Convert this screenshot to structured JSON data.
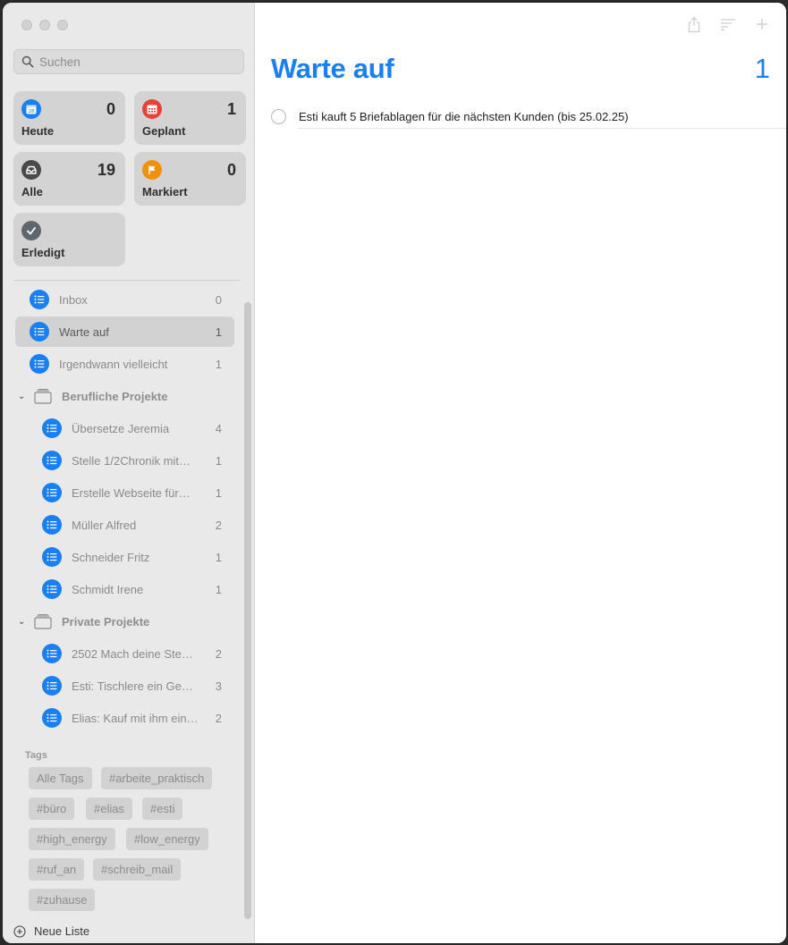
{
  "search": {
    "placeholder": "Suchen"
  },
  "smart_lists": [
    {
      "label": "Heute",
      "count": "0",
      "color": "#1a7ff0",
      "icon": "calendar-icon"
    },
    {
      "label": "Geplant",
      "count": "1",
      "color": "#e8413a",
      "icon": "calendar-grid-icon"
    },
    {
      "label": "Alle",
      "count": "19",
      "color": "#4a4a4a",
      "icon": "inbox-tray-icon"
    },
    {
      "label": "Markiert",
      "count": "0",
      "color": "#f0900c",
      "icon": "flag-icon"
    },
    {
      "label": "Erledigt",
      "count": "",
      "color": "#5e6670",
      "icon": "checkmark-icon"
    }
  ],
  "lists": [
    {
      "name": "Inbox",
      "count": "0"
    },
    {
      "name": "Warte auf",
      "count": "1",
      "selected": true
    },
    {
      "name": "Irgendwann vielleicht",
      "count": "1"
    }
  ],
  "groups": [
    {
      "name": "Berufliche Projekte",
      "items": [
        {
          "name": "Übersetze Jeremia",
          "count": "4"
        },
        {
          "name": "Stelle 1/2Chronik mit…",
          "count": "1"
        },
        {
          "name": "Erstelle Webseite für…",
          "count": "1"
        },
        {
          "name": "Müller Alfred",
          "count": "2"
        },
        {
          "name": "Schneider Fritz",
          "count": "1"
        },
        {
          "name": "Schmidt Irene",
          "count": "1"
        }
      ]
    },
    {
      "name": "Private Projekte",
      "items": [
        {
          "name": "2502 Mach deine Ste…",
          "count": "2"
        },
        {
          "name": "Esti: Tischlere ein Ge…",
          "count": "3"
        },
        {
          "name": "Elias: Kauf mit ihm ein…",
          "count": "2"
        }
      ]
    }
  ],
  "tags": {
    "title": "Tags",
    "items": [
      "Alle Tags",
      "#arbeite_praktisch",
      "#büro",
      "#elias",
      "#esti",
      "#high_energy",
      "#low_energy",
      "#ruf_an",
      "#schreib_mail",
      "#zuhause"
    ]
  },
  "new_list_label": "Neue Liste",
  "main": {
    "title": "Warte auf",
    "count": "1",
    "tasks": [
      {
        "text": "Esti kauft 5 Briefablagen für die nächsten Kunden (bis 25.02.25)"
      }
    ]
  },
  "colors": {
    "accent": "#1a7ff0"
  }
}
